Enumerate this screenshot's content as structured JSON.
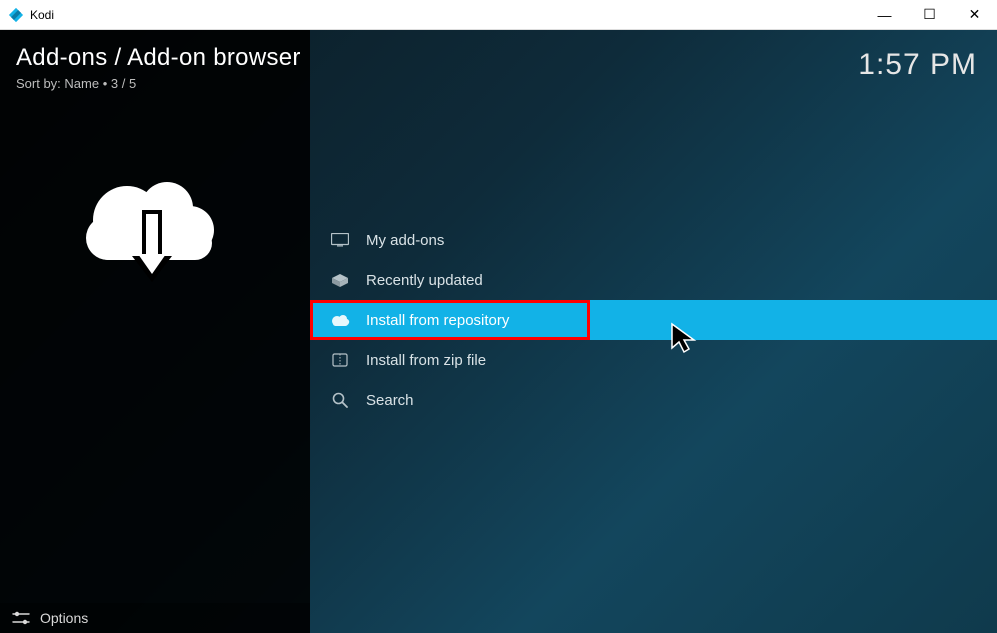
{
  "window": {
    "app_name": "Kodi",
    "minimize": "—",
    "maximize": "☐",
    "close": "✕"
  },
  "header": {
    "breadcrumb": "Add-ons / Add-on browser",
    "sort_prefix": "Sort by: ",
    "sort_field": "Name",
    "sort_separator": "  •  ",
    "sort_count": "3 / 5",
    "clock": "1:57 PM"
  },
  "menu": {
    "items": [
      {
        "label": "My add-ons",
        "selected": false
      },
      {
        "label": "Recently updated",
        "selected": false
      },
      {
        "label": "Install from repository",
        "selected": true
      },
      {
        "label": "Install from zip file",
        "selected": false
      },
      {
        "label": "Search",
        "selected": false
      }
    ]
  },
  "footer": {
    "options_label": "Options"
  }
}
